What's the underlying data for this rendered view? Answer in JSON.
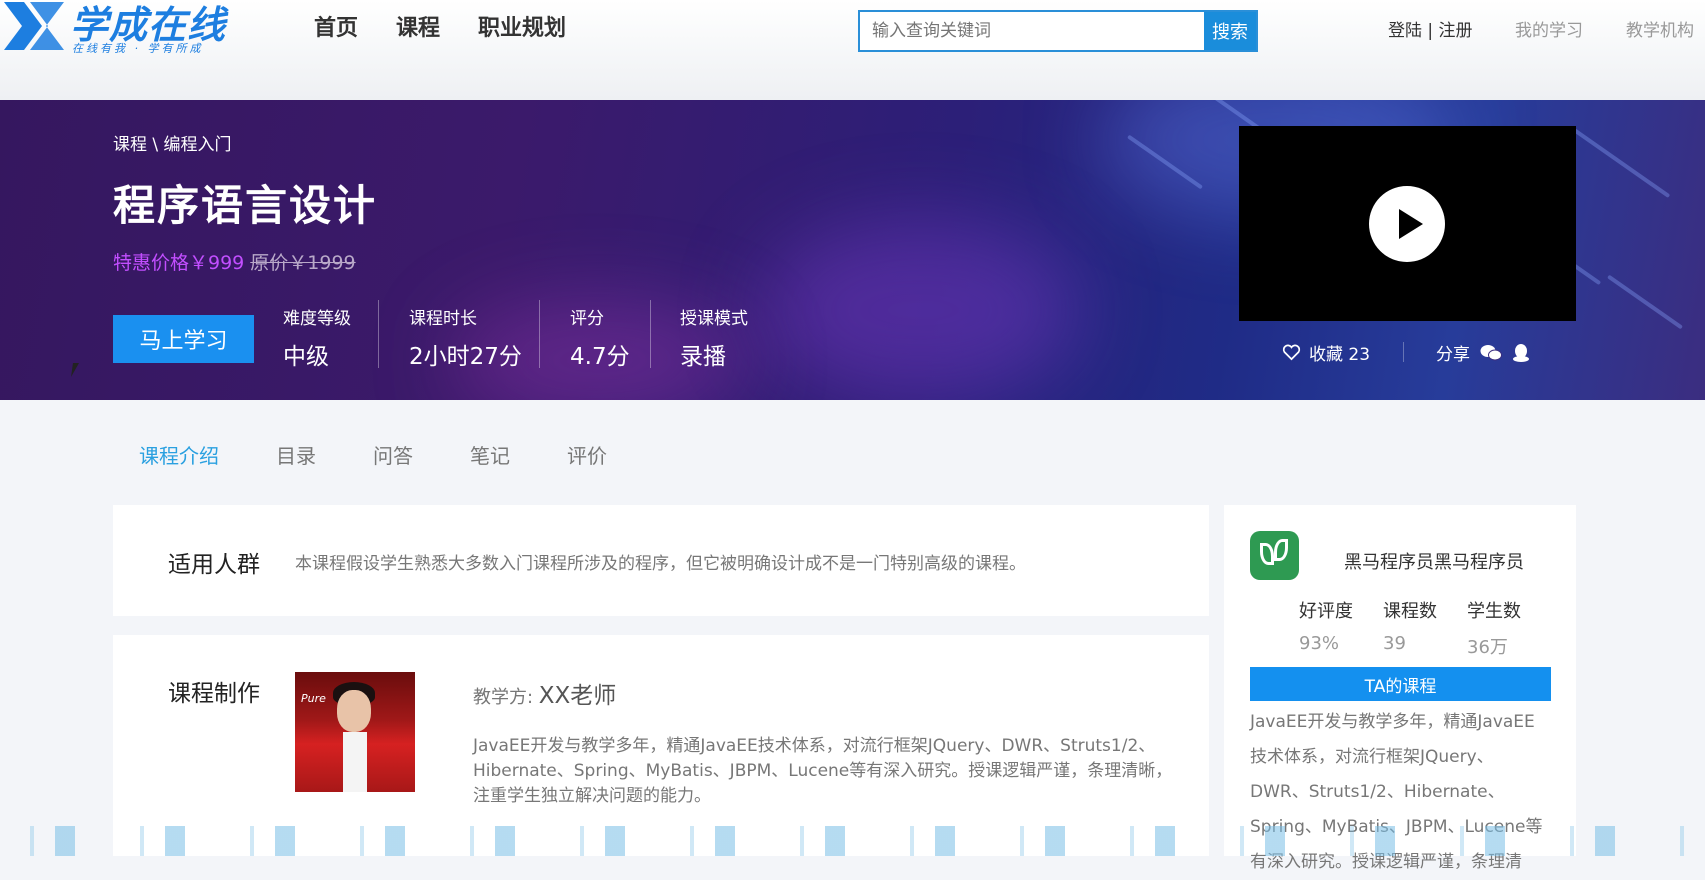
{
  "header": {
    "logo_text": "学成在线",
    "logo_slogan": "在线有我 · 学有所成",
    "nav": [
      "首页",
      "课程",
      "职业规划"
    ],
    "search_placeholder": "输入查询关键词",
    "search_button": "搜索",
    "login": "登陆",
    "divider": "|",
    "register": "注册",
    "my_learning": "我的学习",
    "institution": "教学机构"
  },
  "banner": {
    "breadcrumb": "课程 \\ 编程入门",
    "title": "程序语言设计",
    "sale_price": "特惠价格￥999",
    "original_price": "原价￥1999",
    "learn_button": "马上学习",
    "stats": [
      {
        "label": "难度等级",
        "value": "中级"
      },
      {
        "label": "课程时长",
        "value": "2小时27分"
      },
      {
        "label": "评分",
        "value": "4.7分"
      },
      {
        "label": "授课模式",
        "value": "录播"
      }
    ],
    "favorite": "收藏 23",
    "share": "分享",
    "accent_color": "#c24eff"
  },
  "tabs": [
    {
      "label": "课程介绍",
      "active": true
    },
    {
      "label": "目录",
      "active": false
    },
    {
      "label": "问答",
      "active": false
    },
    {
      "label": "笔记",
      "active": false
    },
    {
      "label": "评价",
      "active": false
    }
  ],
  "audience": {
    "title": "适用人群",
    "text": "本课程假设学生熟悉大多数入门课程所涉及的程序，但它被明确设计成不是一门特别高级的课程。"
  },
  "production": {
    "title": "课程制作",
    "teacher_label": "教学方: ",
    "teacher_name": "XX老师",
    "photo_text": "Pure",
    "description": "JavaEE开发与教学多年，精通JavaEE技术体系，对流行框架JQuery、DWR、Struts1/2、Hibernate、Spring、MyBatis、JBPM、Lucene等有深入研究。授课逻辑严谨，条理清晰，注重学生独立解决问题的能力。"
  },
  "org": {
    "name": "黑马程序员黑马程序员",
    "stats": [
      {
        "label": "好评度",
        "value": "93%"
      },
      {
        "label": "课程数",
        "value": "39"
      },
      {
        "label": "学生数",
        "value": "36万"
      }
    ],
    "ta_button": "TA的课程",
    "description": "JavaEE开发与教学多年，精通JavaEE技术体系，对流行框架JQuery、DWR、Struts1/2、Hibernate、Spring、MyBatis、JBPM、Lucene等有深入研究。授课逻辑严谨，条理清"
  }
}
